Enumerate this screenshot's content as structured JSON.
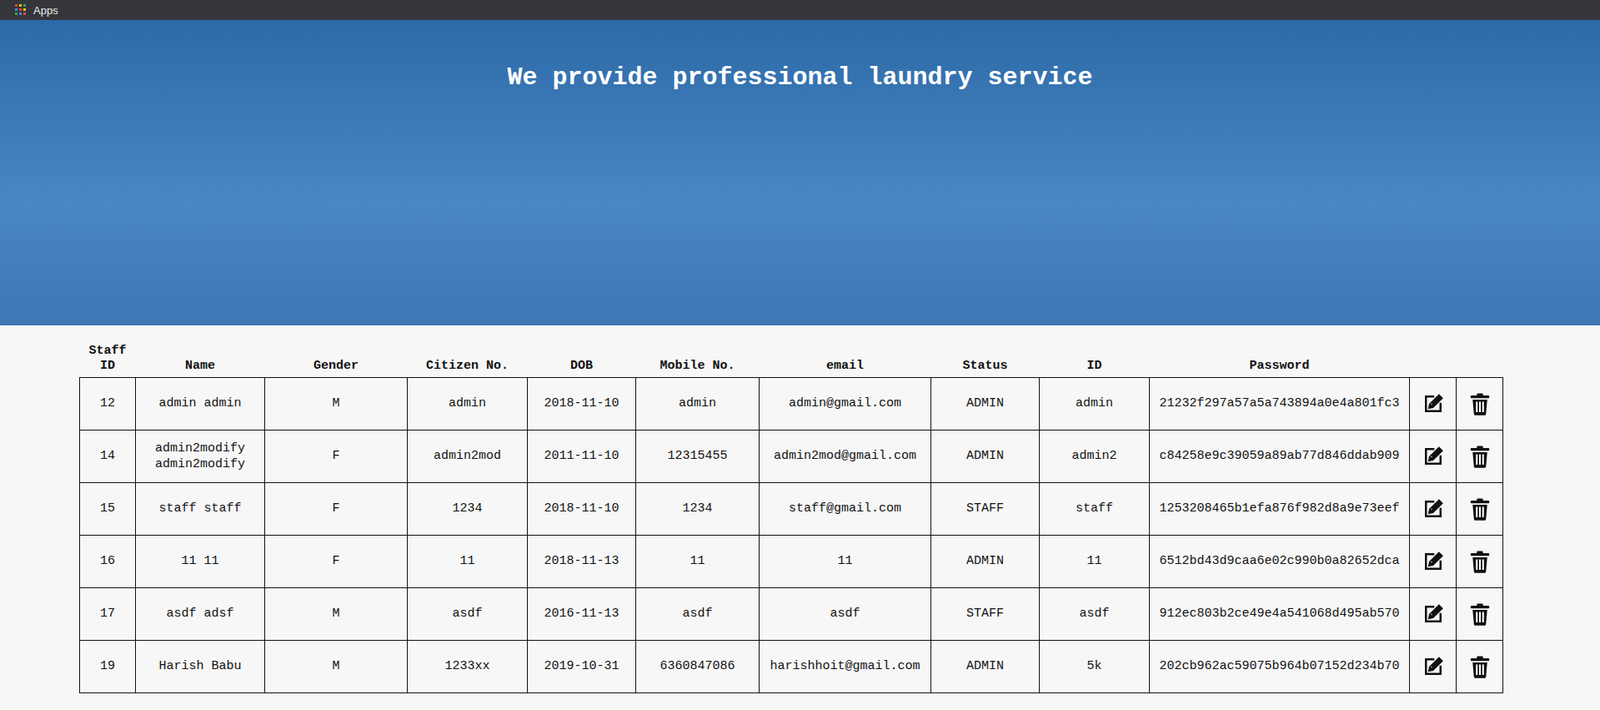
{
  "topbar": {
    "apps_label": "Apps"
  },
  "hero": {
    "heading": "We provide professional laundry service"
  },
  "table": {
    "columns": [
      "Staff ID",
      "Name",
      "Gender",
      "Citizen No.",
      "DOB",
      "Mobile No.",
      "email",
      "Status",
      "ID",
      "Password"
    ],
    "rows": [
      {
        "staff_id": "12",
        "name": "admin admin",
        "gender": "M",
        "citizen_no": "admin",
        "dob": "2018-11-10",
        "mobile": "admin",
        "email": "admin@gmail.com",
        "status": "ADMIN",
        "id": "admin",
        "password": "21232f297a57a5a743894a0e4a801fc3"
      },
      {
        "staff_id": "14",
        "name": "admin2modify admin2modify",
        "gender": "F",
        "citizen_no": "admin2mod",
        "dob": "2011-11-10",
        "mobile": "12315455",
        "email": "admin2mod@gmail.com",
        "status": "ADMIN",
        "id": "admin2",
        "password": "c84258e9c39059a89ab77d846ddab909"
      },
      {
        "staff_id": "15",
        "name": "staff staff",
        "gender": "F",
        "citizen_no": "1234",
        "dob": "2018-11-10",
        "mobile": "1234",
        "email": "staff@gmail.com",
        "status": "STAFF",
        "id": "staff",
        "password": "1253208465b1efa876f982d8a9e73eef"
      },
      {
        "staff_id": "16",
        "name": "11 11",
        "gender": "F",
        "citizen_no": "11",
        "dob": "2018-11-13",
        "mobile": "11",
        "email": "11",
        "status": "ADMIN",
        "id": "11",
        "password": "6512bd43d9caa6e02c990b0a82652dca"
      },
      {
        "staff_id": "17",
        "name": "asdf adsf",
        "gender": "M",
        "citizen_no": "asdf",
        "dob": "2016-11-13",
        "mobile": "asdf",
        "email": "asdf",
        "status": "STAFF",
        "id": "asdf",
        "password": "912ec803b2ce49e4a541068d495ab570"
      },
      {
        "staff_id": "19",
        "name": "Harish Babu",
        "gender": "M",
        "citizen_no": "1233xx",
        "dob": "2019-10-31",
        "mobile": "6360847086",
        "email": "harishhoit@gmail.com",
        "status": "ADMIN",
        "id": "5k",
        "password": "202cb962ac59075b964b07152d234b70"
      }
    ]
  }
}
